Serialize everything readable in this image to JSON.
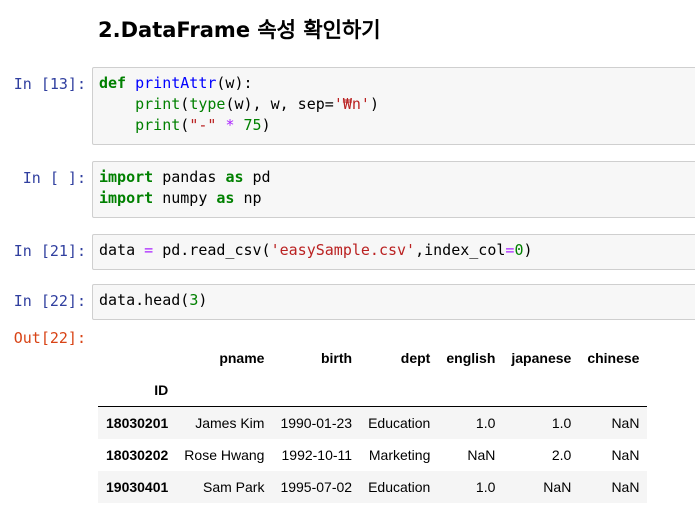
{
  "heading": "2.DataFrame 속성 확인하기",
  "cells": [
    {
      "prompt": "In [13]:",
      "lines": [
        [
          [
            "kwb",
            "def"
          ],
          [
            "t",
            " "
          ],
          [
            "fn",
            "printAttr"
          ],
          [
            "t",
            "(w):"
          ]
        ],
        [
          [
            "t",
            "    "
          ],
          [
            "kw",
            "print"
          ],
          [
            "t",
            "("
          ],
          [
            "kw",
            "type"
          ],
          [
            "t",
            "(w), w, sep="
          ],
          [
            "str",
            "'₩n'"
          ],
          [
            "t",
            ")"
          ]
        ],
        [
          [
            "t",
            "    "
          ],
          [
            "kw",
            "print"
          ],
          [
            "t",
            "("
          ],
          [
            "str",
            "\"-\""
          ],
          [
            "t",
            " "
          ],
          [
            "op",
            "*"
          ],
          [
            "t",
            " "
          ],
          [
            "num",
            "75"
          ],
          [
            "t",
            ")"
          ]
        ]
      ]
    },
    {
      "prompt": "In [ ]:",
      "lines": [
        [
          [
            "kwb",
            "import"
          ],
          [
            "t",
            " pandas "
          ],
          [
            "kwb",
            "as"
          ],
          [
            "t",
            " pd"
          ]
        ],
        [
          [
            "kwb",
            "import"
          ],
          [
            "t",
            " numpy "
          ],
          [
            "kwb",
            "as"
          ],
          [
            "t",
            " np"
          ]
        ]
      ]
    },
    {
      "prompt": "In [21]:",
      "lines": [
        [
          [
            "t",
            "data "
          ],
          [
            "op",
            "="
          ],
          [
            "t",
            " pd.read_csv("
          ],
          [
            "str",
            "'easySample.csv'"
          ],
          [
            "t",
            ",index_col"
          ],
          [
            "op",
            "="
          ],
          [
            "num",
            "0"
          ],
          [
            "t",
            ")"
          ]
        ]
      ]
    },
    {
      "prompt": "In [22]:",
      "lines": [
        [
          [
            "t",
            "data.head("
          ],
          [
            "num",
            "3"
          ],
          [
            "t",
            ")"
          ]
        ]
      ]
    }
  ],
  "output": {
    "prompt": "Out[22]:",
    "columns": [
      "pname",
      "birth",
      "dept",
      "english",
      "japanese",
      "chinese"
    ],
    "index_name": "ID",
    "rows": [
      {
        "id": "18030201",
        "values": [
          "James Kim",
          "1990-01-23",
          "Education",
          "1.0",
          "1.0",
          "NaN"
        ]
      },
      {
        "id": "18030202",
        "values": [
          "Rose Hwang",
          "1992-10-11",
          "Marketing",
          "NaN",
          "2.0",
          "NaN"
        ]
      },
      {
        "id": "19030401",
        "values": [
          "Sam Park",
          "1995-07-02",
          "Education",
          "1.0",
          "NaN",
          "NaN"
        ]
      }
    ]
  }
}
